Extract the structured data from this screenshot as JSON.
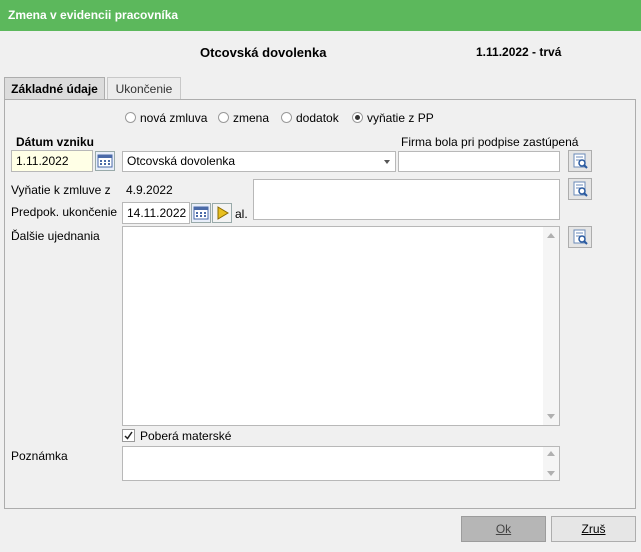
{
  "window": {
    "title": "Zmena v evidencii pracovníka"
  },
  "header": {
    "leave_type": "Otcovská dovolenka",
    "period": "1.11.2022 - trvá"
  },
  "tabs": [
    {
      "label": "Základné údaje"
    },
    {
      "label": "Ukončenie"
    }
  ],
  "radio_options": [
    {
      "label": "nová zmluva",
      "selected": false
    },
    {
      "label": "zmena",
      "selected": false
    },
    {
      "label": "dodatok",
      "selected": false
    },
    {
      "label": "vyňatie z PP",
      "selected": true
    }
  ],
  "form": {
    "date_created_label": "Dátum vzniku",
    "date_created_value": "1.11.2022",
    "type_value": "Otcovská dovolenka",
    "firm_label": "Firma bola pri podpise zastúpená",
    "firm_value": "",
    "exempt_label": "Vyňatie k zmluve z",
    "exempt_value": "4.9.2022",
    "expected_end_label": "Predpok. ukončenie",
    "expected_end_value": "14.11.2022",
    "al_label": "al.",
    "further_label": "Ďalšie ujednania",
    "further_value": "",
    "maternity_label": "Poberá materské",
    "maternity_checked": true,
    "note_label": "Poznámka",
    "note_value": ""
  },
  "buttons": {
    "ok": "Ok",
    "cancel": "Zruš"
  },
  "colors": {
    "titlebar": "#5cb85c",
    "date_field": "#ffffe6"
  }
}
